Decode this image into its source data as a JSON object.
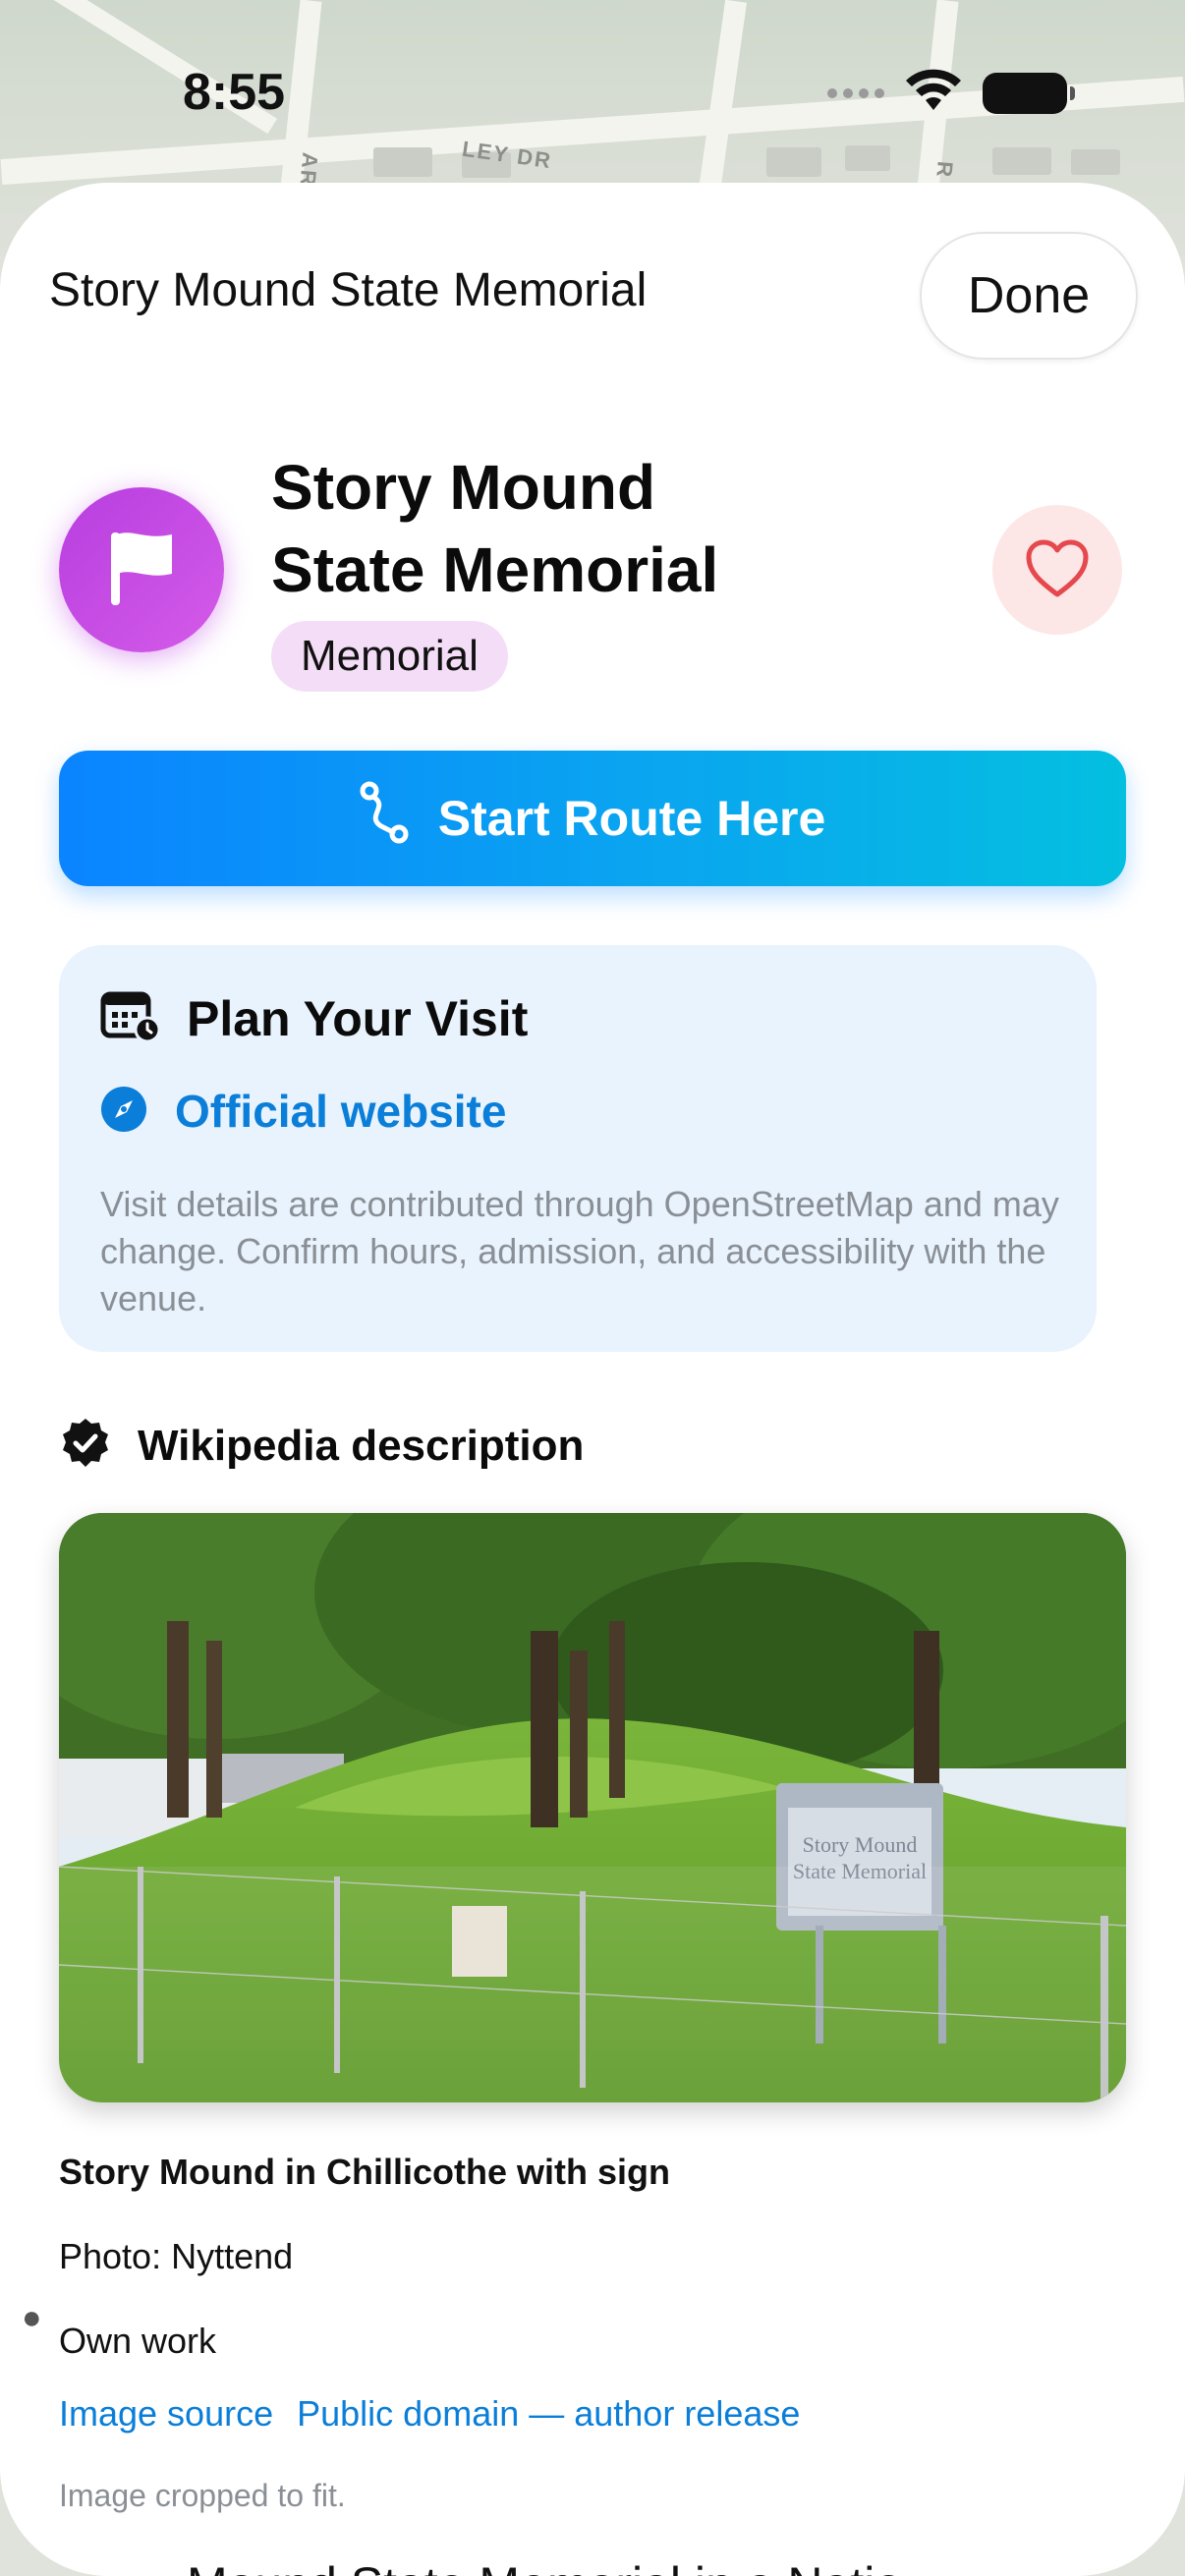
{
  "status_bar": {
    "time": "8:55"
  },
  "map": {
    "street_labels": [
      "LEY DR",
      "AR",
      "R"
    ]
  },
  "sheet": {
    "header_title": "Story Mound State Memorial",
    "done_label": "Done"
  },
  "poi": {
    "title_line1": "Story Mound",
    "title_line2": "State Memorial",
    "category": "Memorial",
    "icon": "flag-icon",
    "icon_color": "#c44ae4"
  },
  "actions": {
    "start_route_label": "Start Route Here",
    "favorite_icon": "heart-icon"
  },
  "visit": {
    "title": "Plan Your Visit",
    "website_label": "Official website",
    "note": "Visit details are contributed through OpenStreetMap and may change. Confirm hours, admission, and accessibility with the venue."
  },
  "wikipedia": {
    "title": "Wikipedia description",
    "photo_sign_line1": "Story Mound",
    "photo_sign_line2": "State Memorial",
    "caption": "Story Mound in Chillicothe with sign",
    "photo_credit": "Photo: Nyttend",
    "license_note": "Own work",
    "image_source_label": "Image source",
    "license_link_label": "Public domain — author release",
    "crop_note": "Image cropped to fit.",
    "next_section_peek": "Mound State Memorial in a Natio"
  },
  "colors": {
    "accent": "#0a84ff",
    "link": "#0a7ed8",
    "card_bg": "#e9f3fd",
    "favorite_bg": "#fde6e6",
    "favorite_stroke": "#e5484d"
  }
}
